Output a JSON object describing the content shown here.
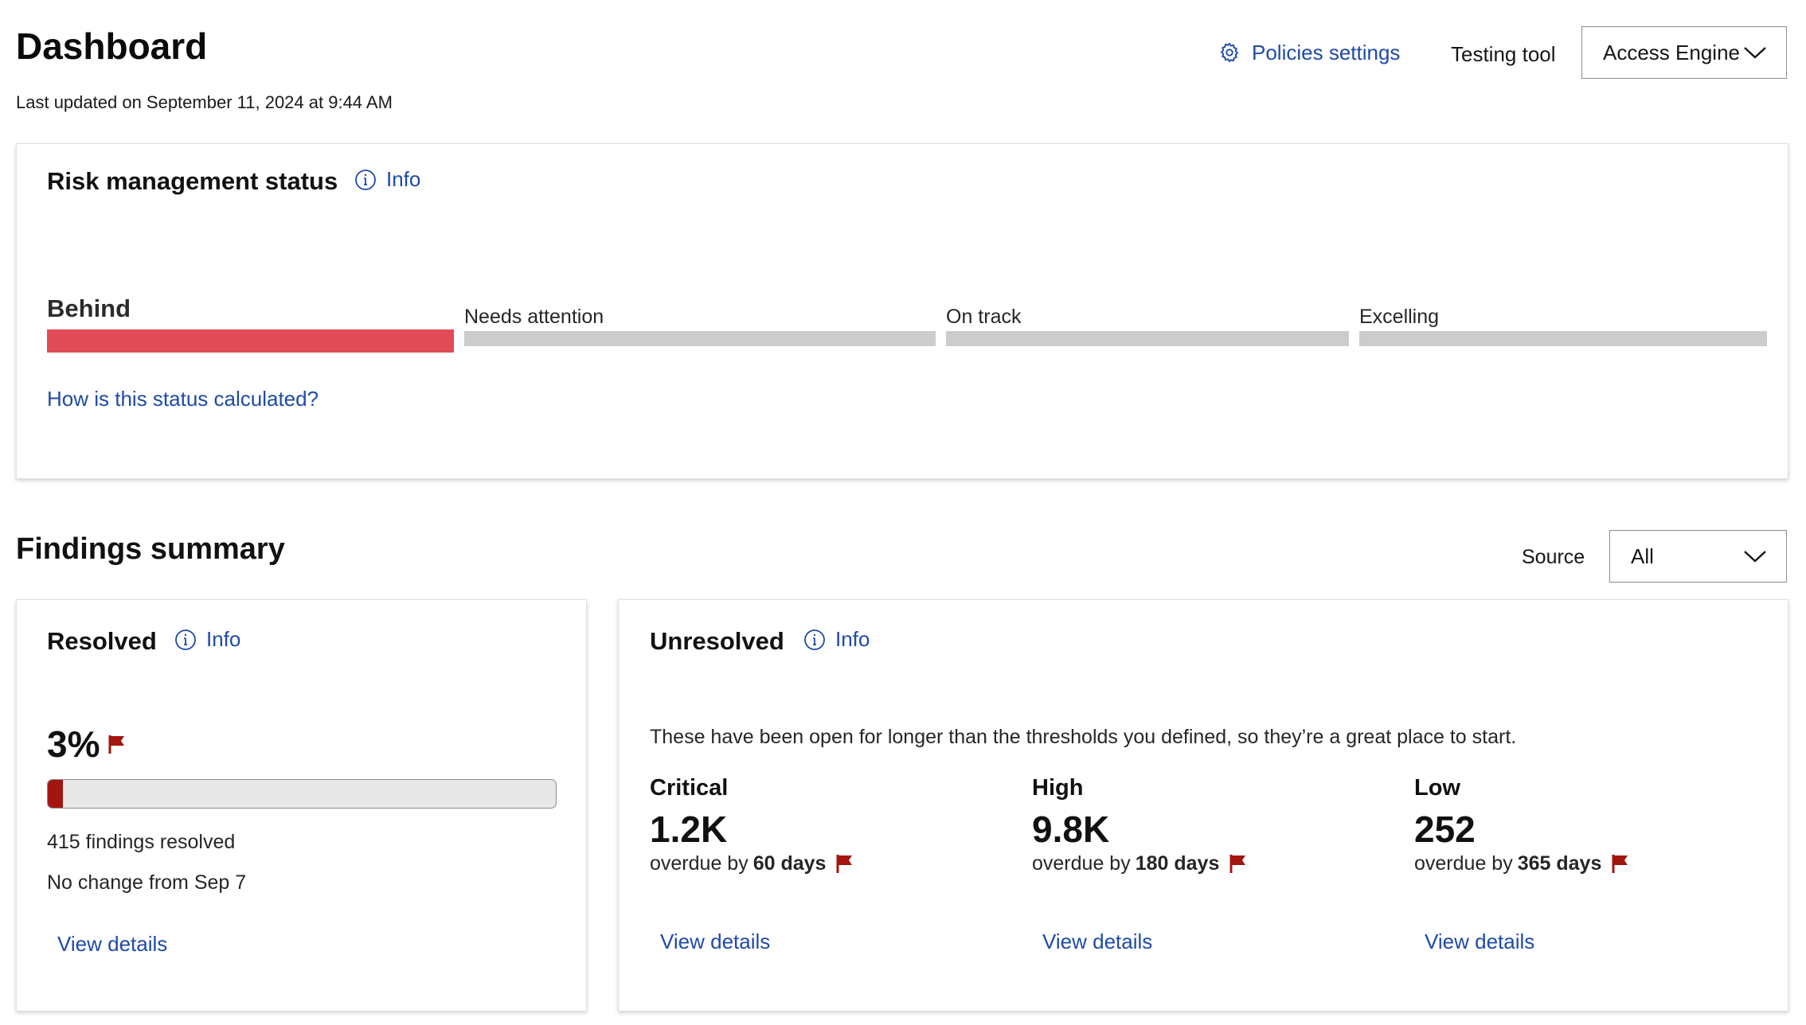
{
  "header": {
    "title": "Dashboard",
    "last_updated": "Last updated on September 11, 2024 at 9:44 AM",
    "policies_settings": "Policies settings",
    "testing_tool": "Testing tool",
    "engine_select_value": "Access Engine"
  },
  "risk": {
    "title": "Risk management status",
    "info": "Info",
    "segments": [
      {
        "label": "Behind",
        "active": true
      },
      {
        "label": "Needs attention",
        "active": false
      },
      {
        "label": "On track",
        "active": false
      },
      {
        "label": "Excelling",
        "active": false
      }
    ],
    "how_link": "How is this status calculated?",
    "colors": {
      "active": "#e14b55",
      "inactive": "#cccccc"
    }
  },
  "findings": {
    "title": "Findings summary",
    "source_label": "Source",
    "source_value": "All",
    "resolved": {
      "title": "Resolved",
      "info": "Info",
      "percent_text": "3%",
      "percent_value": 3,
      "count_text": "415 findings resolved",
      "change_text": "No change from Sep 7",
      "view_details": "View details"
    },
    "unresolved": {
      "title": "Unresolved",
      "info": "Info",
      "description": "These have been open for longer than the thresholds you defined, so they’re a great place to start.",
      "items": [
        {
          "label": "Critical",
          "value": "1.2K",
          "overdue_prefix": "overdue by",
          "overdue_days": "60 days",
          "view_details": "View details"
        },
        {
          "label": "High",
          "value": "9.8K",
          "overdue_prefix": "overdue by",
          "overdue_days": "180 days",
          "view_details": "View details"
        },
        {
          "label": "Low",
          "value": "252",
          "overdue_prefix": "overdue by",
          "overdue_days": "365 days",
          "view_details": "View details"
        }
      ]
    }
  },
  "icons": {
    "settings": "gear-icon",
    "info": "info-icon",
    "chevron": "chevron-down-icon",
    "flag": "flag-icon"
  },
  "accent_color": "#1e4aa8",
  "flag_color": "#a3150f"
}
